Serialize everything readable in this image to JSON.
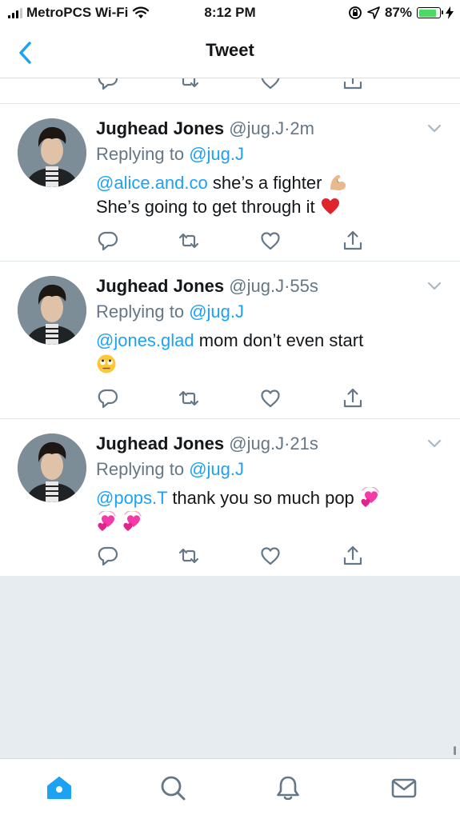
{
  "status_bar": {
    "carrier": "MetroPCS Wi-Fi",
    "time": "8:12 PM",
    "battery": "87%",
    "battery_level": 0.87
  },
  "nav": {
    "title": "Tweet",
    "back_icon": "chevron-left-icon"
  },
  "tweets": [
    {
      "name": "Jughead Jones",
      "handle": "@jug.J",
      "separator": "·",
      "time": "2m",
      "replying_prefix": "Replying to",
      "replying_to": "@jug.J",
      "mention": "@alice.and.co",
      "text": " she’s a fighter",
      "text_line2": "She’s going to get through it",
      "emojis": [
        "flexed-biceps-emoji",
        "red-heart-emoji"
      ]
    },
    {
      "name": "Jughead Jones",
      "handle": "@jug.J",
      "separator": "·",
      "time": "55s",
      "replying_prefix": "Replying to",
      "replying_to": "@jug.J",
      "mention": "@jones.glad",
      "text": " mom don’t even start",
      "emojis": [
        "face-with-rolling-eyes-emoji"
      ]
    },
    {
      "name": "Jughead Jones",
      "handle": "@jug.J",
      "separator": "·",
      "time": "21s",
      "replying_prefix": "Replying to",
      "replying_to": "@jug.J",
      "mention": "@pops.T",
      "text": " thank you so much pop",
      "emojis": [
        "revolving-hearts-emoji",
        "revolving-hearts-emoji",
        "revolving-hearts-emoji"
      ]
    }
  ],
  "tab_bar": {
    "tabs": [
      "home-icon",
      "search-icon",
      "notifications-icon",
      "messages-icon"
    ],
    "active": "home-icon"
  },
  "colors": {
    "accent": "#1da1f2",
    "secondary_text": "#657786",
    "action_icon": "#657786",
    "empty_background": "#e6ecf0",
    "battery_fill": "#4cd964"
  }
}
